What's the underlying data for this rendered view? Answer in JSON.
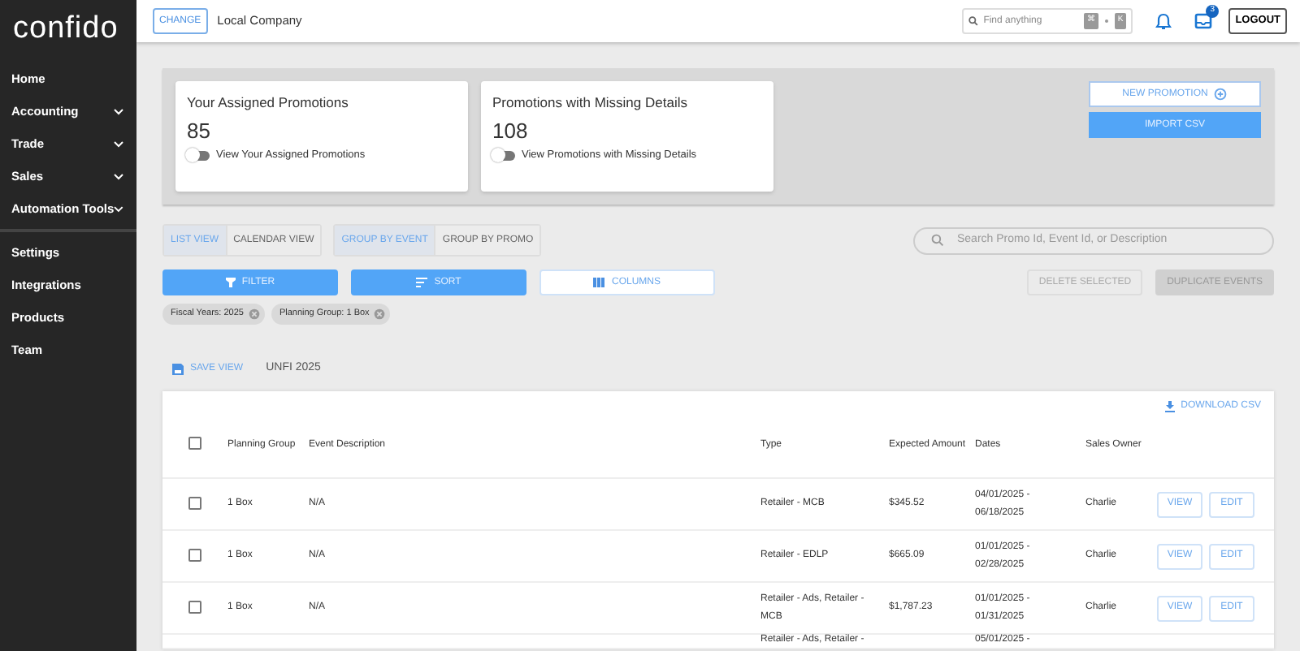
{
  "brand": "confido",
  "company": {
    "button": "CHANGE",
    "name": "Local Company"
  },
  "topbar": {
    "search_placeholder": "Find anything",
    "shortcut_keys": [
      "⌘",
      "K"
    ],
    "notification_count": "3",
    "logout": "LOGOUT"
  },
  "sidebar": {
    "sections": [
      [
        {
          "label": "Home",
          "kind": "link"
        },
        {
          "label": "Accounting",
          "kind": "expandable"
        },
        {
          "label": "Trade",
          "kind": "expandable"
        },
        {
          "label": "Sales",
          "kind": "expandable"
        },
        {
          "label": "Automation Tools",
          "kind": "expandable"
        }
      ],
      [
        {
          "label": "Settings",
          "kind": "link"
        },
        {
          "label": "Integrations",
          "kind": "link"
        },
        {
          "label": "Products",
          "kind": "link"
        },
        {
          "label": "Team",
          "kind": "link"
        }
      ]
    ]
  },
  "summary_cards": [
    {
      "title": "Your Assigned Promotions",
      "count": "85",
      "toggle_label": "View Your Assigned Promotions",
      "on": false
    },
    {
      "title": "Promotions with Missing Details",
      "count": "108",
      "toggle_label": "View Promotions with Missing Details",
      "on": false
    }
  ],
  "actions": {
    "new_promotion": "NEW PROMOTION",
    "import_csv": "IMPORT CSV"
  },
  "view_toggle": [
    {
      "label": "LIST VIEW",
      "selected": true
    },
    {
      "label": "CALENDAR VIEW",
      "selected": false
    }
  ],
  "group_toggle": [
    {
      "label": "GROUP BY EVENT",
      "selected": true
    },
    {
      "label": "GROUP BY PROMO",
      "selected": false
    }
  ],
  "search": {
    "placeholder": "Search Promo Id, Event Id, or Description"
  },
  "tools": [
    {
      "label": "FILTER",
      "kind": "filter"
    },
    {
      "label": "SORT",
      "kind": "sort"
    },
    {
      "label": "COLUMNS",
      "kind": "columns"
    }
  ],
  "bulk_actions": [
    {
      "label": "DELETE SELECTED",
      "kind": "outline",
      "disabled": true
    },
    {
      "label": "DUPLICATE EVENTS",
      "kind": "filled",
      "disabled": true
    }
  ],
  "chips": [
    "Fiscal Years: 2025",
    "Planning Group: 1 Box"
  ],
  "save_view": "SAVE VIEW",
  "view_name": "UNFI 2025",
  "download": "DOWNLOAD CSV",
  "table": {
    "columns": [
      "Planning Group",
      "Event Description",
      "Type",
      "Expected Amount",
      "Dates",
      "Sales Owner"
    ],
    "header_checked": false,
    "rows": [
      {
        "checked": false,
        "cells": [
          "1 Box",
          "N/A",
          "Retailer - MCB",
          "$345.52",
          "04/01/2025 - 06/18/2025",
          "Charlie"
        ],
        "actions": [
          "VIEW",
          "EDIT"
        ]
      },
      {
        "checked": false,
        "cells": [
          "1 Box",
          "N/A",
          "Retailer - EDLP",
          "$665.09",
          "01/01/2025 - 02/28/2025",
          "Charlie"
        ],
        "actions": [
          "VIEW",
          "EDIT"
        ]
      },
      {
        "checked": false,
        "cells": [
          "1 Box",
          "N/A",
          "Retailer - Ads, Retailer - MCB",
          "$1,787.23",
          "01/01/2025 - 01/31/2025",
          "Charlie"
        ],
        "actions": [
          "VIEW",
          "EDIT"
        ]
      },
      {
        "cells": [
          "",
          "",
          "Retailer - Ads, Retailer -",
          "",
          "05/01/2025 -",
          ""
        ],
        "actions": []
      }
    ]
  }
}
